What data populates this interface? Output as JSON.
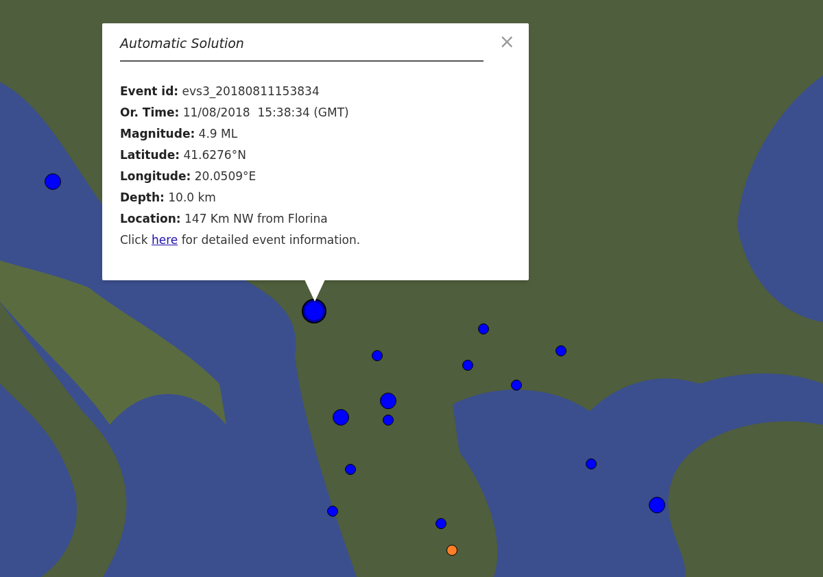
{
  "popup": {
    "title": "Automatic Solution",
    "close": "×",
    "fields": [
      {
        "label": "Event id:",
        "value": "evs3_20180811153834"
      },
      {
        "label": "Or. Time:",
        "value": "11/08/2018  15:38:34 (GMT)"
      },
      {
        "label": "Magnitude:",
        "value": "4.9 ML"
      },
      {
        "label": "Latitude:",
        "value": "41.6276°N"
      },
      {
        "label": "Longitude:",
        "value": "20.0509°E"
      },
      {
        "label": "Depth:",
        "value": "10.0 km"
      },
      {
        "label": "Location:",
        "value": "147 Km NW from Florina"
      }
    ],
    "link_sentence": {
      "before": "Click",
      "link": "here",
      "after": "for detailed event information."
    }
  },
  "markers": [
    {
      "kind": "large",
      "color": "#0000ff",
      "selected": false
    },
    {
      "kind": "large",
      "color": "#0000ff",
      "selected": true
    },
    {
      "kind": "small",
      "color": "#0000ff",
      "selected": false
    },
    {
      "kind": "small",
      "color": "#0000ff",
      "selected": false
    },
    {
      "kind": "small",
      "color": "#0000ff",
      "selected": false
    },
    {
      "kind": "small",
      "color": "#0000ff",
      "selected": false
    },
    {
      "kind": "small",
      "color": "#0000ff",
      "selected": false
    },
    {
      "kind": "large",
      "color": "#0000ff",
      "selected": false
    },
    {
      "kind": "large",
      "color": "#0000ff",
      "selected": false
    },
    {
      "kind": "small",
      "color": "#0000ff",
      "selected": false
    },
    {
      "kind": "small",
      "color": "#0000ff",
      "selected": false
    },
    {
      "kind": "small",
      "color": "#0000ff",
      "selected": false
    },
    {
      "kind": "large",
      "color": "#0000ff",
      "selected": false
    },
    {
      "kind": "small",
      "color": "#0000ff",
      "selected": false
    },
    {
      "kind": "small",
      "color": "#0000ff",
      "selected": false
    },
    {
      "kind": "small",
      "color": "#ff7f27",
      "selected": false
    }
  ]
}
